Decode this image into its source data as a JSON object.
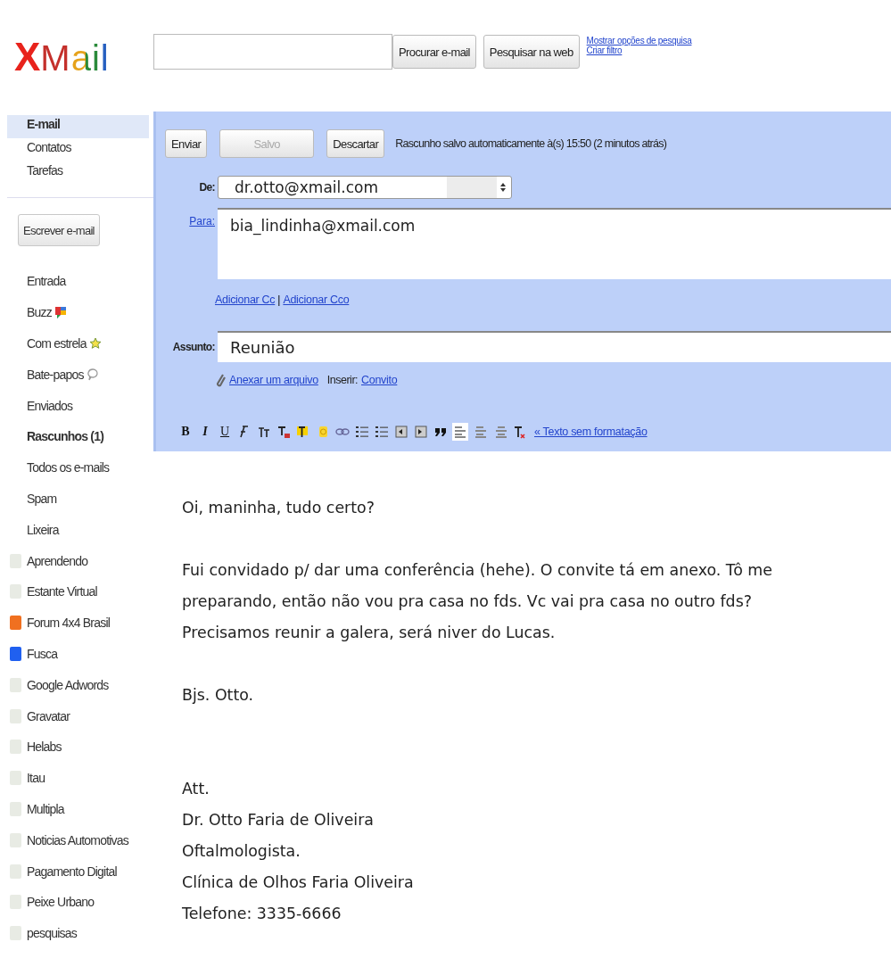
{
  "header": {
    "logo": {
      "first": "X",
      "rest": "Mail"
    },
    "search": {
      "buttons": [
        "Procurar e-mail",
        "Pesquisar na web"
      ]
    },
    "links": [
      "Mostrar opções de pesquisa",
      "Criar filtro"
    ]
  },
  "sidebar": {
    "nav": [
      {
        "label": "E-mail",
        "selected": true
      },
      {
        "label": "Contatos",
        "selected": false
      },
      {
        "label": "Tarefas",
        "selected": false
      }
    ],
    "compose_button": "Escrever e-mail",
    "folders": [
      {
        "label": "Entrada",
        "bold": false,
        "kind": "plain"
      },
      {
        "label": "Buzz",
        "bold": false,
        "kind": "buzz"
      },
      {
        "label": "Com estrela",
        "bold": false,
        "kind": "star"
      },
      {
        "label": "Bate-papos",
        "bold": false,
        "kind": "chat"
      },
      {
        "label": "Enviados",
        "bold": false,
        "kind": "plain"
      },
      {
        "label": "Rascunhos (1)",
        "bold": true,
        "kind": "plain"
      },
      {
        "label": "Todos os e-mails",
        "bold": false,
        "kind": "plain"
      },
      {
        "label": "Spam",
        "bold": false,
        "kind": "plain"
      },
      {
        "label": "Lixeira",
        "bold": false,
        "kind": "plain"
      }
    ],
    "labels": [
      {
        "label": "Aprendendo",
        "color": "#e8ebe4"
      },
      {
        "label": "Estante Virtual",
        "color": "#e8ebe4"
      },
      {
        "label": "Forum 4x4 Brasil",
        "color": "#f07020"
      },
      {
        "label": "Fusca",
        "color": "#2060f0"
      },
      {
        "label": "Google Adwords",
        "color": "#e8ebe4"
      },
      {
        "label": "Gravatar",
        "color": "#e8ebe4"
      },
      {
        "label": "Helabs",
        "color": "#e8ebe4"
      },
      {
        "label": "Itau",
        "color": "#e8ebe4"
      },
      {
        "label": "Multipla",
        "color": "#e8ebe4"
      },
      {
        "label": "Noticias Automotivas",
        "color": "#e8ebe4"
      },
      {
        "label": "Pagamento Digital",
        "color": "#e8ebe4"
      },
      {
        "label": "Peixe Urbano",
        "color": "#e8ebe4"
      },
      {
        "label": "pesquisas",
        "color": "#e8ebe4"
      }
    ]
  },
  "compose": {
    "actions": [
      {
        "label": "Enviar",
        "disabled": false
      },
      {
        "label": "Salvo",
        "disabled": true
      },
      {
        "label": "Descartar",
        "disabled": false
      }
    ],
    "status": "Rascunho salvo automaticamente à(s) 15:50 (2 minutos atrás)",
    "from": {
      "label": "De:",
      "value": "dr.otto@xmail.com"
    },
    "to": {
      "label": "Para:",
      "value": "bia_lindinha@xmail.com"
    },
    "cc_links": [
      "Adicionar Cc",
      "Adicionar Cco"
    ],
    "cc_separator": "|",
    "subject": {
      "label": "Assunto:",
      "value": "Reunião"
    },
    "attach": {
      "link": "Anexar um arquivo",
      "insert_label": "Inserir:",
      "insert_link": "Convito"
    },
    "toolbar": [
      {
        "kind": "bold",
        "label": "B",
        "selected": false
      },
      {
        "kind": "italic",
        "label": "I",
        "selected": false
      },
      {
        "kind": "underline",
        "label": "U",
        "selected": false
      },
      {
        "kind": "font",
        "selected": false
      },
      {
        "kind": "size",
        "selected": false
      },
      {
        "kind": "color",
        "selected": false
      },
      {
        "kind": "highlight",
        "selected": false
      },
      {
        "kind": "emoji",
        "selected": false
      },
      {
        "kind": "link",
        "selected": false
      },
      {
        "kind": "ol",
        "selected": false
      },
      {
        "kind": "ul",
        "selected": false
      },
      {
        "kind": "outdent",
        "selected": false
      },
      {
        "kind": "indent",
        "selected": false
      },
      {
        "kind": "quote",
        "selected": false
      },
      {
        "kind": "align-left",
        "selected": true
      },
      {
        "kind": "align-center",
        "selected": false
      },
      {
        "kind": "align-right",
        "selected": false
      },
      {
        "kind": "clear",
        "selected": false
      }
    ],
    "plain_text_link": "« Texto sem formatação",
    "body": [
      {
        "kind": "text",
        "lines": [
          "Oi, maninha, tudo certo?"
        ]
      },
      {
        "kind": "text",
        "lines": [
          "Fui convidado p/ dar uma conferência (hehe). O convite tá em anexo. Tô me",
          "preparando, então não vou pra casa no fds. Vc vai pra casa no outro fds?",
          "Precisamos reunir a galera, será niver do Lucas."
        ]
      },
      {
        "kind": "text",
        "lines": [
          "Bjs. Otto."
        ]
      },
      {
        "kind": "signature",
        "lines": [
          "Att.",
          "Dr. Otto Faria de Oliveira",
          "Oftalmologista.",
          "Clínica de Olhos Faria Oliveira",
          "Telefone: 3335-6666"
        ]
      }
    ]
  }
}
